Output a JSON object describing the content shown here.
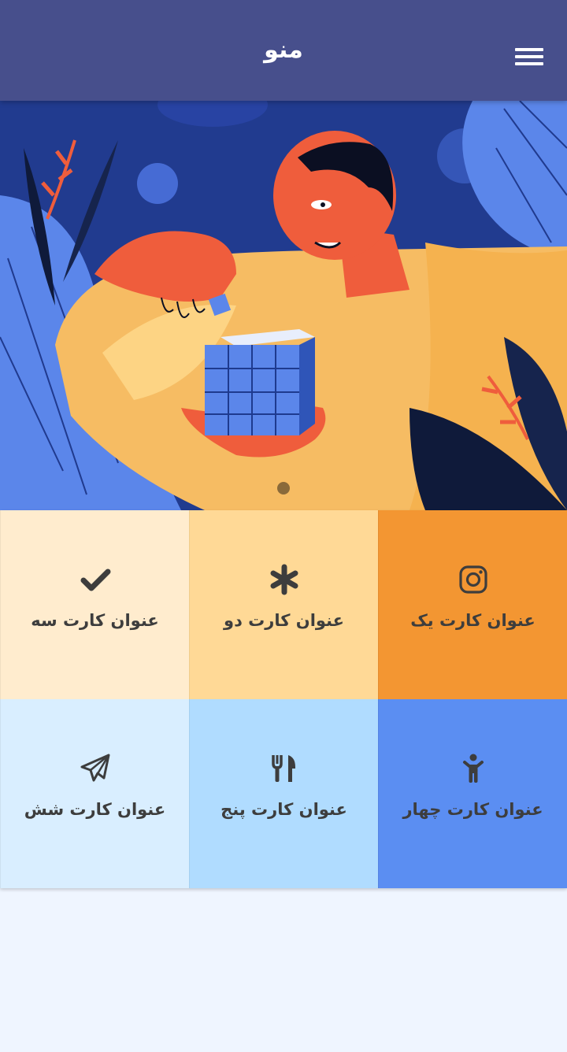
{
  "header": {
    "title": "منو",
    "menu_icon": "hamburger-icon"
  },
  "hero": {
    "slide_count": 1,
    "active_slide": 1
  },
  "cards": [
    {
      "label": "عنوان کارت یک",
      "icon": "instagram-icon",
      "bg": "#f39632"
    },
    {
      "label": "عنوان کارت دو",
      "icon": "asterisk-icon",
      "bg": "#ffd996"
    },
    {
      "label": "عنوان کارت سه",
      "icon": "check-icon",
      "bg": "#ffecce"
    },
    {
      "label": "عنوان کارت چهار",
      "icon": "child-icon",
      "bg": "#5b8ef2"
    },
    {
      "label": "عنوان کارت پنج",
      "icon": "utensils-icon",
      "bg": "#b0dcff"
    },
    {
      "label": "عنوان کارت شش",
      "icon": "paper-plane-icon",
      "bg": "#d9eeff"
    }
  ],
  "colors": {
    "appbar": "#474f8c",
    "page_bg": "#eff5ff",
    "icon": "#3d3d3d"
  }
}
